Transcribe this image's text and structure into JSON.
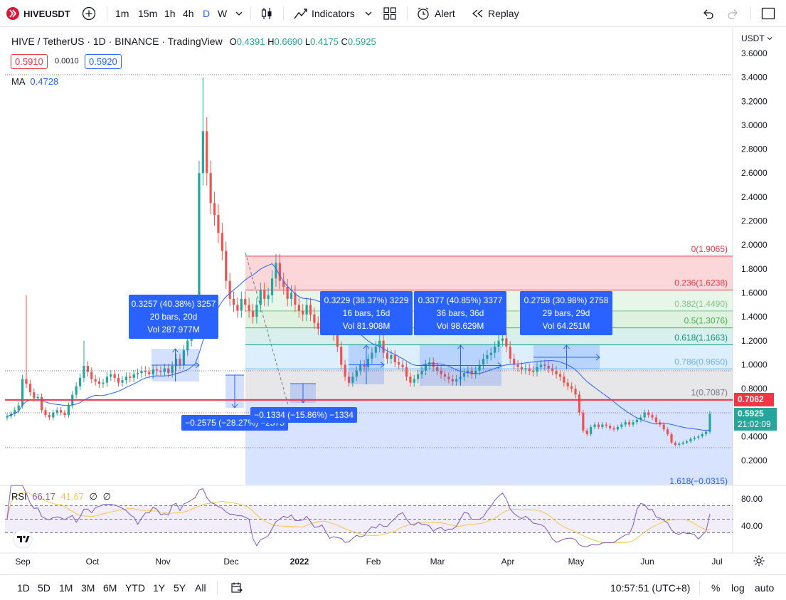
{
  "toolbar": {
    "symbol": "HIVEUSDT",
    "intervals": [
      "1m",
      "15m",
      "1h",
      "4h",
      "D",
      "W"
    ],
    "active_interval": "D",
    "indicators_label": "Indicators",
    "alert_label": "Alert",
    "replay_label": "Replay"
  },
  "legend": {
    "title": "HIVE / TetherUS · 1D · BINANCE · TradingView",
    "ohlc": {
      "o_label": "O",
      "o": "0.4391",
      "h_label": "H",
      "h": "0.6690",
      "l_label": "L",
      "l": "0.4175",
      "c_label": "C",
      "c": "0.5925"
    },
    "sell_price": "0.5910",
    "spread": "0.0010",
    "buy_price": "0.5920",
    "ma_label": "MA",
    "ma_value": "0.4728"
  },
  "rsi": {
    "label": "RSI",
    "value1": "66.17",
    "value2": "41.67",
    "value3": "∅",
    "value4": "∅"
  },
  "axis": {
    "currency": "USDT",
    "price_ticks": [
      "3.6000",
      "3.4000",
      "3.2000",
      "3.0000",
      "2.8000",
      "2.6000",
      "2.4000",
      "2.2000",
      "2.0000",
      "1.8000",
      "1.6000",
      "1.4000",
      "1.2000",
      "1.0000",
      "0.8000",
      "0.4000",
      "0.2000"
    ],
    "rsi_ticks": [
      "80.00",
      "40.00"
    ],
    "time_ticks": [
      "Sep",
      "Oct",
      "Nov",
      "Dec",
      "2022",
      "Feb",
      "Mar",
      "Apr",
      "May",
      "Jun",
      "Jul"
    ],
    "hline_price": "0.7062",
    "last_price": "0.5925",
    "countdown": "21:02:09"
  },
  "fib": [
    "0(1.9065)",
    "0.236(1.6238)",
    "0.382(1.4490)",
    "0.5(1.3076)",
    "0.618(1.1663)",
    "0.786(0.9650)",
    "1(0.7087)",
    "1.618(−0.0315)"
  ],
  "measures": [
    {
      "line1": "0.3257 (40.38%) 3257",
      "line2": "20 bars, 20d",
      "line3": "Vol 287.977M"
    },
    {
      "line1": "0.3229 (38.37%) 3229",
      "line2": "16 bars, 16d",
      "line3": "Vol 81.908M"
    },
    {
      "line1": "0.3377 (40.85%) 3377",
      "line2": "36 bars, 36d",
      "line3": "Vol 98.629M"
    },
    {
      "line1": "0.2758 (30.98%) 2758",
      "line2": "29 bars, 29d",
      "line3": "Vol 64.251M"
    },
    {
      "line1": "−0.2575 (−28.27%) −2575"
    },
    {
      "line1": "−0.1334 (−15.86%) −1334"
    }
  ],
  "bottom": {
    "ranges": [
      "1D",
      "5D",
      "1M",
      "3M",
      "6M",
      "YTD",
      "1Y",
      "5Y",
      "All"
    ],
    "time": "10:57:51 (UTC+8)",
    "percent": "%",
    "log": "log",
    "auto": "auto"
  },
  "colors": {
    "up": "#26a69a",
    "down": "#ef5350",
    "accent": "#2962ff",
    "ma": "#2962ff",
    "rsi": "#7e57c2",
    "rsi_ma": "#f7c548",
    "hline": "#f23645"
  },
  "chart_data": {
    "type": "candlestick",
    "symbol": "HIVE / TetherUS",
    "ylim": [
      0,
      3.7
    ],
    "close_series": [
      0.57,
      0.59,
      0.62,
      0.66,
      0.88,
      0.84,
      0.77,
      0.72,
      0.73,
      0.62,
      0.58,
      0.56,
      0.6,
      0.62,
      0.6,
      0.58,
      0.66,
      0.75,
      0.82,
      0.89,
      0.99,
      0.94,
      0.88,
      0.86,
      0.84,
      0.85,
      0.9,
      0.92,
      0.89,
      0.85,
      0.87,
      0.9,
      0.89,
      0.92,
      0.93,
      0.95,
      0.94,
      0.92,
      0.96,
      0.95,
      0.94,
      0.97,
      0.93,
      0.99,
      1.05,
      1.0,
      1.12,
      1.2,
      1.3,
      1.45,
      2.6,
      2.95,
      2.6,
      2.35,
      2.25,
      2.1,
      1.95,
      1.7,
      1.55,
      1.5,
      1.45,
      1.55,
      1.5,
      1.45,
      1.4,
      1.5,
      1.62,
      1.55,
      1.58,
      1.72,
      1.85,
      1.7,
      1.65,
      1.55,
      1.6,
      1.5,
      1.45,
      1.42,
      1.5,
      1.42,
      1.35,
      1.3,
      1.38,
      1.32,
      1.3,
      1.25,
      1.15,
      1.0,
      0.9,
      0.85,
      0.9,
      0.95,
      1.0,
      0.98,
      1.05,
      1.1,
      1.15,
      1.2,
      1.1,
      1.05,
      1.08,
      1.02,
      1.0,
      0.98,
      0.9,
      0.85,
      0.88,
      0.92,
      0.95,
      1.0,
      1.02,
      0.98,
      0.95,
      0.92,
      0.9,
      0.88,
      0.86,
      0.88,
      0.9,
      0.93,
      0.95,
      0.92,
      0.95,
      1.0,
      1.05,
      1.08,
      1.1,
      1.15,
      1.2,
      1.22,
      1.15,
      1.05,
      1.0,
      0.98,
      0.96,
      0.97,
      0.95,
      0.94,
      0.98,
      1.0,
      0.99,
      0.97,
      0.95,
      0.92,
      0.9,
      0.85,
      0.82,
      0.8,
      0.75,
      0.6,
      0.45,
      0.42,
      0.48,
      0.5,
      0.48,
      0.5,
      0.49,
      0.47,
      0.46,
      0.48,
      0.5,
      0.52,
      0.5,
      0.52,
      0.54,
      0.56,
      0.6,
      0.58,
      0.56,
      0.52,
      0.5,
      0.46,
      0.42,
      0.35,
      0.33,
      0.34,
      0.35,
      0.36,
      0.38,
      0.39,
      0.4,
      0.42,
      0.44,
      0.59
    ]
  }
}
